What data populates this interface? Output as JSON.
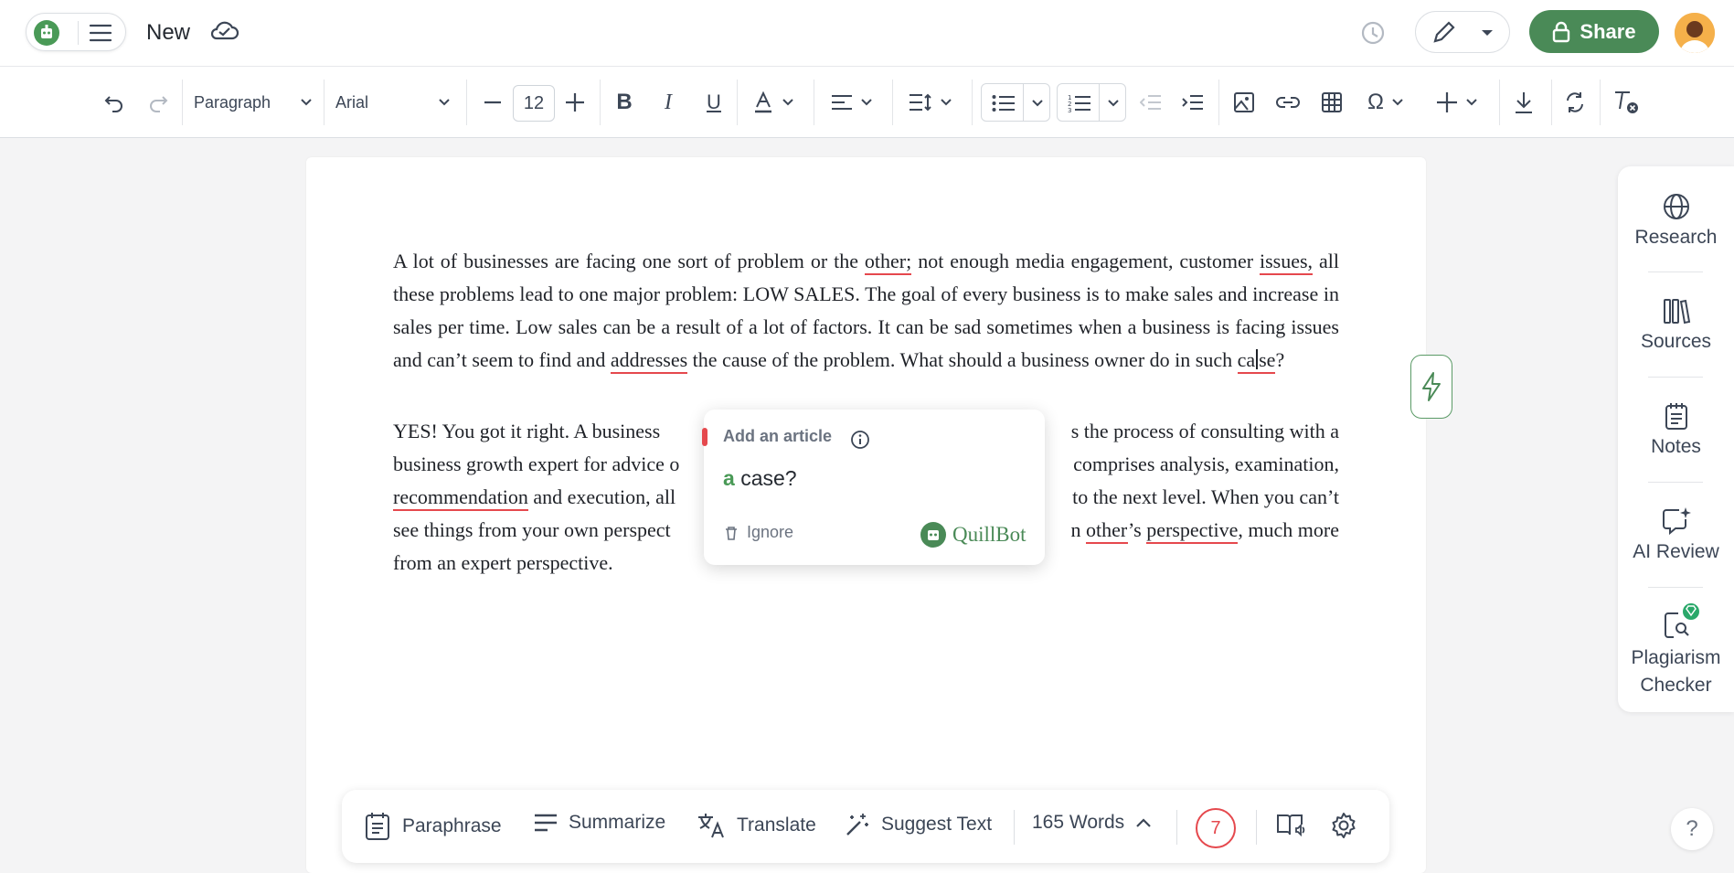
{
  "header": {
    "doc_title": "New",
    "share_label": "Share"
  },
  "toolbar": {
    "paragraph_style": "Paragraph",
    "font_family": "Arial",
    "font_size": "12"
  },
  "document": {
    "para1": [
      {
        "t": "A lot of businesses are facing one sort of problem or the "
      },
      {
        "t": "other;",
        "u": true
      },
      {
        "t": " not enough media engagement, customer "
      },
      {
        "t": "issues,",
        "u": true
      },
      {
        "t": " all these problems lead to one major problem: LOW SALES. The goal of every business is to make sales and increase in sales per time. Low sales can be a result of a lot of factors. It can be sad sometimes when a business is facing issues and can’t seem to find and "
      },
      {
        "t": "addresses",
        "u": true
      },
      {
        "t": " the cause of the problem. What should a business owner do in such "
      },
      {
        "t": "case",
        "u": true,
        "cursor": true
      },
      {
        "t": "?"
      }
    ],
    "para2_lines": [
      [
        "YES! You got it right. A business ",
        "",
        "s the process of consulting with a"
      ],
      [
        "business growth expert for advice o",
        "",
        "comprises analysis, examination,"
      ],
      [
        "",
        "and execution, all",
        "to the next level. When you can’t"
      ],
      [
        "see things from your own perspect",
        "",
        "much more"
      ],
      [
        "from an expert perspective."
      ]
    ],
    "para2_words": {
      "recommendation": "recommendation",
      "other": "other",
      "possessive": "’s",
      "perspective": "perspective",
      "n": "n",
      "comma": ","
    }
  },
  "popup": {
    "title": "Add an article",
    "suggestion_article": "a",
    "suggestion_word": "case?",
    "ignore_label": "Ignore",
    "brand": "QuillBot"
  },
  "right_panel": {
    "items": [
      {
        "label": "Research",
        "icon": "globe-icon"
      },
      {
        "label": "Sources",
        "icon": "books-icon"
      },
      {
        "label": "Notes",
        "icon": "notes-icon"
      },
      {
        "label": "AI Review",
        "icon": "sparkle-chat-icon"
      },
      {
        "label": "Plagiarism",
        "label2": "Checker",
        "icon": "plagiarism-icon"
      }
    ]
  },
  "bottom_bar": {
    "paraphrase": "Paraphrase",
    "summarize": "Summarize",
    "translate": "Translate",
    "suggest_text": "Suggest Text",
    "word_count": "165 Words",
    "issue_count": "7"
  },
  "help_label": "?",
  "colors": {
    "brand_green": "#4a8a57",
    "error_red": "#e5484d"
  }
}
